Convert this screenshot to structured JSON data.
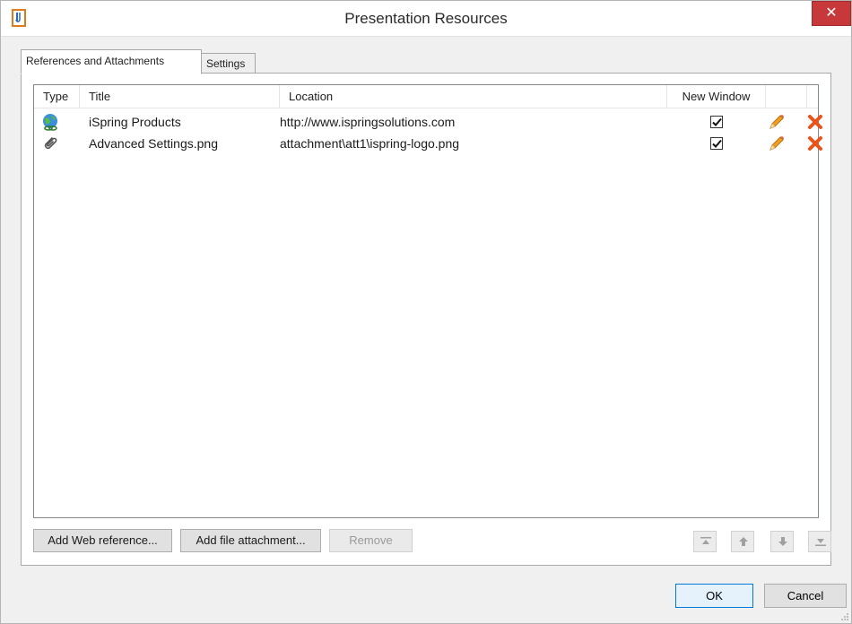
{
  "window": {
    "title": "Presentation Resources",
    "close_glyph": "✕"
  },
  "tabs": [
    {
      "label": "References and Attachments",
      "active": true
    },
    {
      "label": "Settings",
      "active": false
    }
  ],
  "table": {
    "columns": [
      "Type",
      "Title",
      "Location",
      "New Window",
      "",
      ""
    ],
    "rows": [
      {
        "type_icon": "globe-link-icon",
        "title": "iSpring Products",
        "location": "http://www.ispringsolutions.com",
        "new_window": true
      },
      {
        "type_icon": "paperclip-icon",
        "title": "Advanced Settings.png",
        "location": "attachment\\att1\\ispring-logo.png",
        "new_window": true
      }
    ]
  },
  "actions": {
    "add_web": "Add Web reference...",
    "add_file": "Add file attachment...",
    "remove": "Remove"
  },
  "dialog": {
    "ok": "OK",
    "cancel": "Cancel"
  },
  "colors": {
    "close_red": "#c7383b",
    "delete_orange": "#e8541c",
    "pencil_orange": "#f0a020",
    "ok_border": "#0078d7"
  }
}
